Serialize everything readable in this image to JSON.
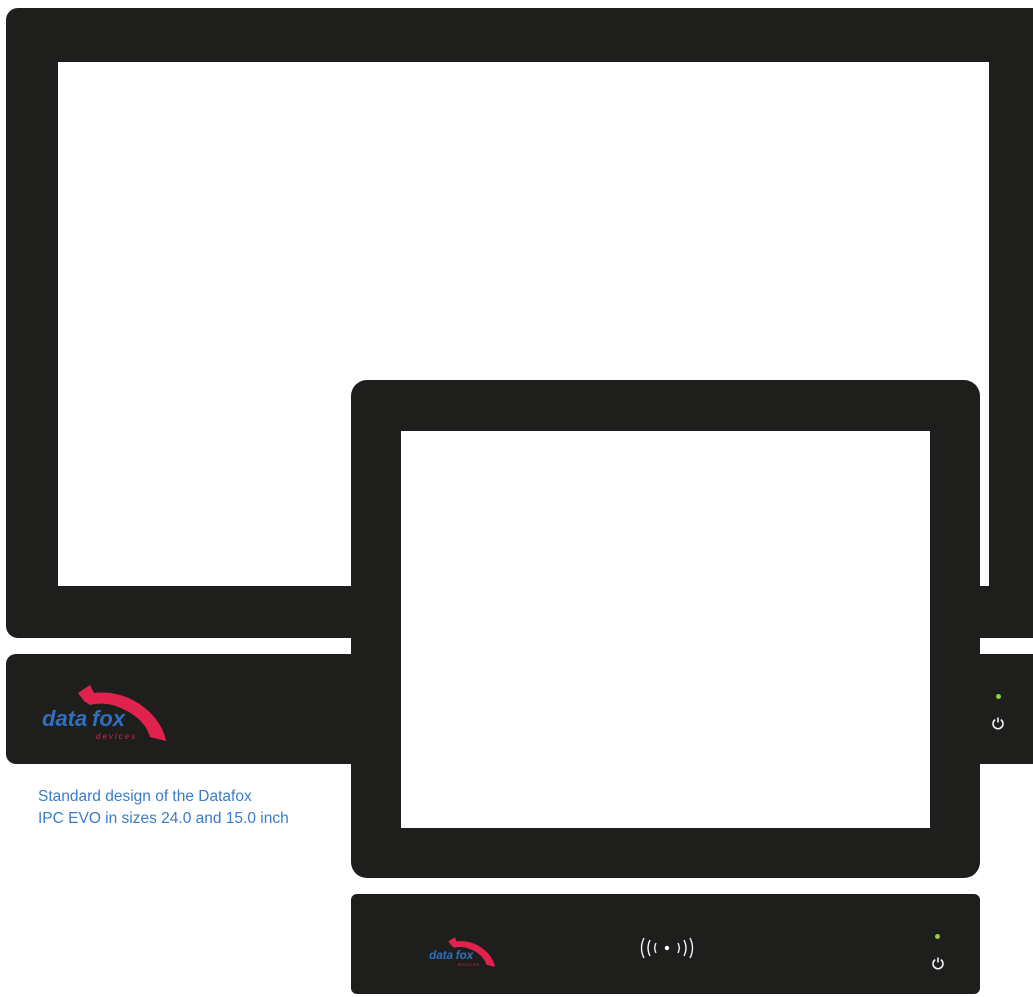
{
  "caption": {
    "line1": "Standard design of the Datafox",
    "line2": "IPC EVO in sizes 24.0 and 15.0 inch"
  },
  "logo": {
    "word_data": "data",
    "word_fox": "fox",
    "sub": "devices"
  },
  "colors": {
    "device_body": "#1e1e1c",
    "screen": "#ffffff",
    "caption_text": "#3a7cc4",
    "logo_blue": "#2f6fc0",
    "logo_red": "#e0234e",
    "status_led": "#8bd13d",
    "icon_white": "#ffffff"
  },
  "icons": {
    "power": "power-icon",
    "rfid": "rfid-contactless-icon",
    "led": "status-led"
  }
}
